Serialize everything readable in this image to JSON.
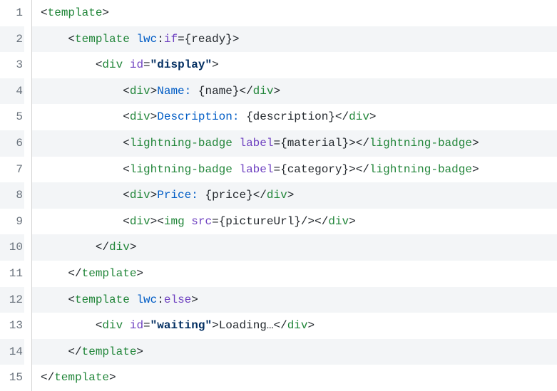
{
  "lines": [
    {
      "num": "1",
      "indent": 0,
      "tokens": [
        [
          "p",
          "<"
        ],
        [
          "tg",
          "template"
        ],
        [
          "p",
          ">"
        ]
      ]
    },
    {
      "num": "2",
      "indent": 1,
      "tokens": [
        [
          "p",
          "<"
        ],
        [
          "tg",
          "template"
        ],
        [
          "txp",
          " "
        ],
        [
          "nm",
          "lwc"
        ],
        [
          "p",
          ":"
        ],
        [
          "an",
          "if"
        ],
        [
          "op",
          "="
        ],
        [
          "av",
          "{ready}"
        ],
        [
          "p",
          ">"
        ]
      ]
    },
    {
      "num": "3",
      "indent": 2,
      "tokens": [
        [
          "p",
          "<"
        ],
        [
          "tg",
          "div"
        ],
        [
          "txp",
          " "
        ],
        [
          "an",
          "id"
        ],
        [
          "op",
          "="
        ],
        [
          "str",
          "\"display\""
        ],
        [
          "p",
          ">"
        ]
      ]
    },
    {
      "num": "4",
      "indent": 3,
      "tokens": [
        [
          "p",
          "<"
        ],
        [
          "tg",
          "div"
        ],
        [
          "p",
          ">"
        ],
        [
          "tx",
          "Name: "
        ],
        [
          "av",
          "{name}"
        ],
        [
          "p",
          "</"
        ],
        [
          "tg",
          "div"
        ],
        [
          "p",
          ">"
        ]
      ]
    },
    {
      "num": "5",
      "indent": 3,
      "tokens": [
        [
          "p",
          "<"
        ],
        [
          "tg",
          "div"
        ],
        [
          "p",
          ">"
        ],
        [
          "tx",
          "Description: "
        ],
        [
          "av",
          "{description}"
        ],
        [
          "p",
          "</"
        ],
        [
          "tg",
          "div"
        ],
        [
          "p",
          ">"
        ]
      ]
    },
    {
      "num": "6",
      "indent": 3,
      "tokens": [
        [
          "p",
          "<"
        ],
        [
          "tg",
          "lightning-badge"
        ],
        [
          "txp",
          " "
        ],
        [
          "an",
          "label"
        ],
        [
          "op",
          "="
        ],
        [
          "av",
          "{material}"
        ],
        [
          "p",
          "></"
        ],
        [
          "tg",
          "lightning-badge"
        ],
        [
          "p",
          ">"
        ]
      ]
    },
    {
      "num": "7",
      "indent": 3,
      "tokens": [
        [
          "p",
          "<"
        ],
        [
          "tg",
          "lightning-badge"
        ],
        [
          "txp",
          " "
        ],
        [
          "an",
          "label"
        ],
        [
          "op",
          "="
        ],
        [
          "av",
          "{category}"
        ],
        [
          "p",
          "></"
        ],
        [
          "tg",
          "lightning-badge"
        ],
        [
          "p",
          ">"
        ]
      ]
    },
    {
      "num": "8",
      "indent": 3,
      "tokens": [
        [
          "p",
          "<"
        ],
        [
          "tg",
          "div"
        ],
        [
          "p",
          ">"
        ],
        [
          "tx",
          "Price: "
        ],
        [
          "av",
          "{price}"
        ],
        [
          "p",
          "</"
        ],
        [
          "tg",
          "div"
        ],
        [
          "p",
          ">"
        ]
      ]
    },
    {
      "num": "9",
      "indent": 3,
      "tokens": [
        [
          "p",
          "<"
        ],
        [
          "tg",
          "div"
        ],
        [
          "p",
          ">"
        ],
        [
          "p",
          "<"
        ],
        [
          "tg",
          "img"
        ],
        [
          "txp",
          " "
        ],
        [
          "an",
          "src"
        ],
        [
          "op",
          "="
        ],
        [
          "av",
          "{pictureUrl}"
        ],
        [
          "p",
          "/>"
        ],
        [
          "p",
          "</"
        ],
        [
          "tg",
          "div"
        ],
        [
          "p",
          ">"
        ]
      ]
    },
    {
      "num": "10",
      "indent": 2,
      "tokens": [
        [
          "p",
          "</"
        ],
        [
          "tg",
          "div"
        ],
        [
          "p",
          ">"
        ]
      ]
    },
    {
      "num": "11",
      "indent": 1,
      "tokens": [
        [
          "p",
          "</"
        ],
        [
          "tg",
          "template"
        ],
        [
          "p",
          ">"
        ]
      ]
    },
    {
      "num": "12",
      "indent": 1,
      "tokens": [
        [
          "p",
          "<"
        ],
        [
          "tg",
          "template"
        ],
        [
          "txp",
          " "
        ],
        [
          "nm",
          "lwc"
        ],
        [
          "p",
          ":"
        ],
        [
          "an",
          "else"
        ],
        [
          "p",
          ">"
        ]
      ]
    },
    {
      "num": "13",
      "indent": 2,
      "tokens": [
        [
          "p",
          "<"
        ],
        [
          "tg",
          "div"
        ],
        [
          "txp",
          " "
        ],
        [
          "an",
          "id"
        ],
        [
          "op",
          "="
        ],
        [
          "str",
          "\"waiting\""
        ],
        [
          "p",
          ">"
        ],
        [
          "txp",
          "Loading…"
        ],
        [
          "p",
          "</"
        ],
        [
          "tg",
          "div"
        ],
        [
          "p",
          ">"
        ]
      ]
    },
    {
      "num": "14",
      "indent": 1,
      "tokens": [
        [
          "p",
          "</"
        ],
        [
          "tg",
          "template"
        ],
        [
          "p",
          ">"
        ]
      ]
    },
    {
      "num": "15",
      "indent": 0,
      "tokens": [
        [
          "p",
          "</"
        ],
        [
          "tg",
          "template"
        ],
        [
          "p",
          ">"
        ]
      ]
    }
  ],
  "indentUnit": "    "
}
